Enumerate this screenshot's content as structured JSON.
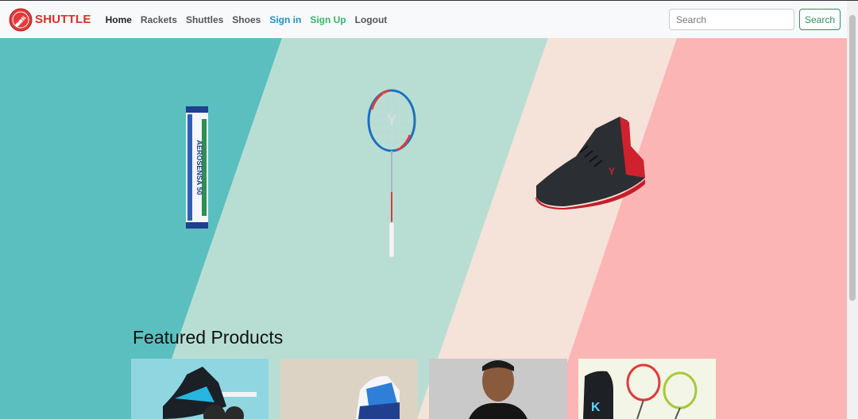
{
  "brand": {
    "name": "SHUTTLE",
    "logo_icon": "shuttlecock-logo-icon"
  },
  "nav": {
    "home": "Home",
    "rackets": "Rackets",
    "shuttles": "Shuttles",
    "shoes": "Shoes",
    "signin": "Sign in",
    "signup": "Sign Up",
    "logout": "Logout"
  },
  "search": {
    "placeholder": "Search",
    "button_label": "Search"
  },
  "hero": {
    "shuttle_tube_text": "AEROSENSA 50",
    "colors": [
      "#5bbfbf",
      "#b8ded4",
      "#f5e2d8",
      "#fbb5b5"
    ]
  },
  "featured": {
    "title": "Featured Products"
  },
  "colors": {
    "brand": "#d93025",
    "signin": "#1f8fc7",
    "signup": "#34b86a",
    "search_btn": "#2f8f62"
  }
}
